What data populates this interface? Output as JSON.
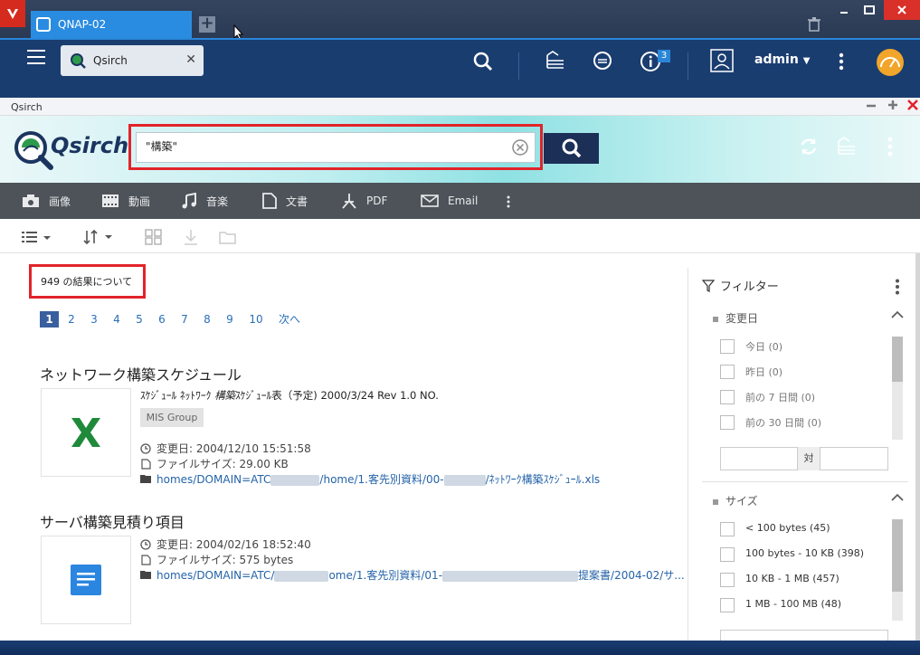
{
  "browser": {
    "tab_title": "QNAP-02"
  },
  "header": {
    "app_tab": "Qsirch",
    "info_badge": "3",
    "user": "admin"
  },
  "window": {
    "title": "Qsirch"
  },
  "qsirch": {
    "logo_text": "Qsirch",
    "search_value": "\"構築\""
  },
  "categories": [
    {
      "label": "画像",
      "icon": "camera-icon"
    },
    {
      "label": "動画",
      "icon": "film-icon"
    },
    {
      "label": "音楽",
      "icon": "music-icon"
    },
    {
      "label": "文書",
      "icon": "document-icon"
    },
    {
      "label": "PDF",
      "icon": "pdf-icon"
    },
    {
      "label": "Email",
      "icon": "mail-icon"
    }
  ],
  "results": {
    "count_text": "949 の結果について",
    "pages": [
      "1",
      "2",
      "3",
      "4",
      "5",
      "6",
      "7",
      "8",
      "9",
      "10"
    ],
    "next": "次へ",
    "items": [
      {
        "title": "ネットワーク構築スケジュール",
        "snippet_pre": "ｽｹｼﾞｭｰﾙ ﾈｯﾄﾜｰｸ ",
        "snippet_em": "構築",
        "snippet_post": "ｽｹｼﾞｭｰﾙ表（予定) 2000/3/24 Rev 1.0 NO.",
        "tag": "MIS Group",
        "modified": "変更日: 2004/12/10 15:51:58",
        "size": "ファイルサイズ: 29.00 KB",
        "path_a": "homes/DOMAIN=ATC",
        "path_b": "/home/1.客先別資料/00-",
        "path_c": "/ﾈｯﾄﾜｰｸ構築ｽｹｼﾞｭｰﾙ.xls",
        "type": "excel"
      },
      {
        "title": "サーバ構築見積り項目",
        "modified": "変更日: 2004/02/16 18:52:40",
        "size": "ファイルサイズ: 575 bytes",
        "path_a": "homes/DOMAIN=ATC/",
        "path_b": "ome/1.客先別資料/01-",
        "path_c": "提案書/2004-02/サ...",
        "type": "doc"
      }
    ]
  },
  "filter": {
    "title": "フィルター",
    "modified_section": "変更日",
    "modified_options": [
      "今日 (0)",
      "昨日 (0)",
      "前の 7 日間 (0)",
      "前の 30 日間 (0)"
    ],
    "range_sep": "対",
    "size_section": "サイズ",
    "size_options": [
      "< 100 bytes (45)",
      "100 bytes - 10 KB (398)",
      "10 KB - 1 MB (457)",
      "1 MB - 100 MB (48)"
    ]
  }
}
